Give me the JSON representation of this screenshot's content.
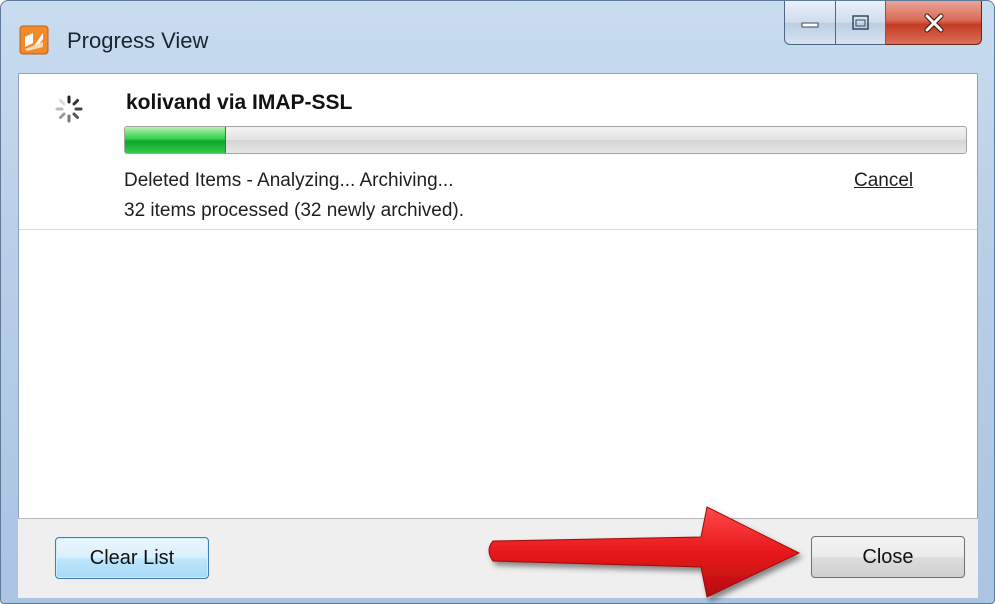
{
  "window": {
    "title": "Progress View",
    "app_icon": "app-logo-icon",
    "caption_buttons": {
      "minimize": "minimize-icon",
      "maximize": "maximize-icon",
      "close": "close-icon"
    }
  },
  "progress_item": {
    "spinner_icon": "spinner-icon",
    "title": "kolivand via IMAP-SSL",
    "progress_fraction": 0.12,
    "status_text": "Deleted Items - Analyzing... Archiving...",
    "count_text": "32 items processed (32 newly archived).",
    "cancel_label": "Cancel"
  },
  "footer": {
    "clear_list_label": "Clear List",
    "close_label": "Close"
  },
  "annotation": {
    "arrow_color": "#e8181b",
    "arrow_icon": "red-arrow-annotation"
  },
  "colors": {
    "progress_green": "#0ea52a",
    "app_icon_orange": "#f08a2a",
    "close_red": "#c43b22"
  }
}
